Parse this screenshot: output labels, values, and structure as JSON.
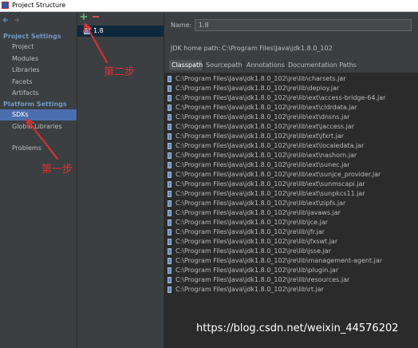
{
  "window": {
    "title": "Project Structure"
  },
  "left_nav": {
    "project_settings_header": "Project Settings",
    "project_items": [
      "Project",
      "Modules",
      "Libraries",
      "Facets",
      "Artifacts"
    ],
    "platform_settings_header": "Platform Settings",
    "platform_items": [
      "SDKs",
      "Global Libraries"
    ],
    "selected_item": "SDKs",
    "problems": "Problems"
  },
  "sdk_list": {
    "items": [
      "1.8"
    ],
    "selected": "1.8"
  },
  "details": {
    "name_label": "Name:",
    "name_value": "1.8",
    "jdk_home_label": "JDK home path:",
    "jdk_home_value": "C:\\Program Files\\Java\\jdk1.8.0_102",
    "tabs": [
      "Classpath",
      "Sourcepath",
      "Annotations",
      "Documentation Paths"
    ],
    "active_tab": "Classpath",
    "classpath": [
      "C:\\Program Files\\Java\\jdk1.8.0_102\\jre\\lib\\charsets.jar",
      "C:\\Program Files\\Java\\jdk1.8.0_102\\jre\\lib\\deploy.jar",
      "C:\\Program Files\\Java\\jdk1.8.0_102\\jre\\lib\\ext\\access-bridge-64.jar",
      "C:\\Program Files\\Java\\jdk1.8.0_102\\jre\\lib\\ext\\cldrdata.jar",
      "C:\\Program Files\\Java\\jdk1.8.0_102\\jre\\lib\\ext\\dnsns.jar",
      "C:\\Program Files\\Java\\jdk1.8.0_102\\jre\\lib\\ext\\jaccess.jar",
      "C:\\Program Files\\Java\\jdk1.8.0_102\\jre\\lib\\ext\\jfxrt.jar",
      "C:\\Program Files\\Java\\jdk1.8.0_102\\jre\\lib\\ext\\localedata.jar",
      "C:\\Program Files\\Java\\jdk1.8.0_102\\jre\\lib\\ext\\nashorn.jar",
      "C:\\Program Files\\Java\\jdk1.8.0_102\\jre\\lib\\ext\\sunec.jar",
      "C:\\Program Files\\Java\\jdk1.8.0_102\\jre\\lib\\ext\\sunjce_provider.jar",
      "C:\\Program Files\\Java\\jdk1.8.0_102\\jre\\lib\\ext\\sunmscapi.jar",
      "C:\\Program Files\\Java\\jdk1.8.0_102\\jre\\lib\\ext\\sunpkcs11.jar",
      "C:\\Program Files\\Java\\jdk1.8.0_102\\jre\\lib\\ext\\zipfs.jar",
      "C:\\Program Files\\Java\\jdk1.8.0_102\\jre\\lib\\javaws.jar",
      "C:\\Program Files\\Java\\jdk1.8.0_102\\jre\\lib\\jce.jar",
      "C:\\Program Files\\Java\\jdk1.8.0_102\\jre\\lib\\jfr.jar",
      "C:\\Program Files\\Java\\jdk1.8.0_102\\jre\\lib\\jfxswt.jar",
      "C:\\Program Files\\Java\\jdk1.8.0_102\\jre\\lib\\jsse.jar",
      "C:\\Program Files\\Java\\jdk1.8.0_102\\jre\\lib\\management-agent.jar",
      "C:\\Program Files\\Java\\jdk1.8.0_102\\jre\\lib\\plugin.jar",
      "C:\\Program Files\\Java\\jdk1.8.0_102\\jre\\lib\\resources.jar",
      "C:\\Program Files\\Java\\jdk1.8.0_102\\jre\\lib\\rt.jar"
    ]
  },
  "annotations": {
    "step1": "第一步",
    "step2": "第二步"
  },
  "watermark": "https://blog.csdn.net/weixin_44576202",
  "colors": {
    "selection": "#4b6eaf",
    "annotation_red": "#e03030",
    "section_header": "#6f98c7",
    "add_green": "#59a869",
    "remove_red": "#c75450"
  },
  "icons": {
    "back": "back-arrow-icon",
    "forward": "forward-arrow-icon",
    "add": "plus-icon",
    "remove": "minus-icon",
    "jar": "jar-icon",
    "sdk": "folder-icon"
  }
}
